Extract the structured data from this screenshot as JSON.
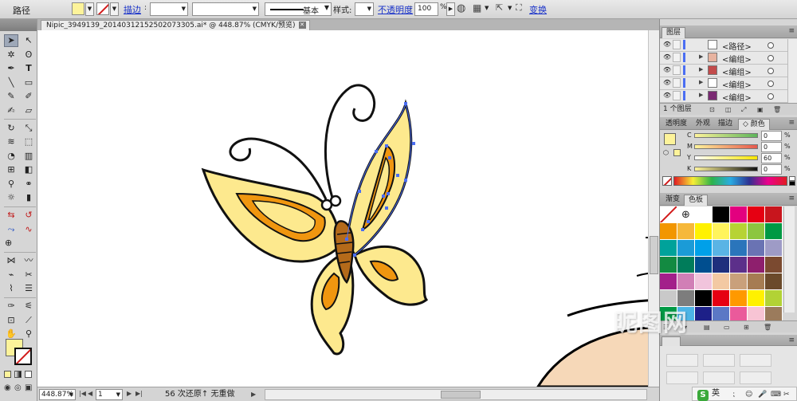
{
  "control_bar": {
    "title": "路径",
    "stroke_link": "描边",
    "stroke_width": "",
    "stroke_profile": "",
    "brush_label": "基本",
    "style_label": "样式:",
    "opacity_link": "不透明度",
    "opacity_value": "100",
    "opacity_unit": "%",
    "transform_link": "变换",
    "colors": {
      "fill": "#fdf39a",
      "accent_link": "#1a33c9"
    }
  },
  "document": {
    "tab_title": "Nipic_3949139_20140312152502073305.ai* @ 448.87% (CMYK/预览)"
  },
  "status_bar": {
    "zoom": "448.87%",
    "page": "1",
    "status_text": "56 次还原↑ 无重做"
  },
  "layers_panel": {
    "tab": "图层",
    "layers": [
      {
        "name": "<路径>"
      },
      {
        "name": "<编组>"
      },
      {
        "name": "<编组>"
      },
      {
        "name": "<编组>"
      },
      {
        "name": "<编组>"
      }
    ],
    "footer": "1 个图层"
  },
  "color_panel": {
    "tabs": [
      "透明度",
      "外观",
      "描边",
      "颜色"
    ],
    "active_tab": "颜色",
    "channels": [
      {
        "label": "C",
        "value": "0",
        "unit": "%",
        "color": "#00a7d8"
      },
      {
        "label": "M",
        "value": "0",
        "unit": "%",
        "color": "#e6007e"
      },
      {
        "label": "Y",
        "value": "60",
        "unit": "%",
        "color": "#f7e500"
      },
      {
        "label": "K",
        "value": "0",
        "unit": "%",
        "color": "#000000"
      }
    ]
  },
  "swatches_panel": {
    "tabs": [
      "渐变",
      "色板"
    ],
    "active_tab": "色板",
    "swatches": [
      "#ffffff",
      "#ffffff",
      "#ffffff",
      "#000000",
      "#e3007f",
      "#e60012",
      "#c8151d",
      "#f29600",
      "#f6b83a",
      "#fff100",
      "#fff45c",
      "#b7d334",
      "#8cc63f",
      "#009944",
      "#00a29a",
      "#1b9bd7",
      "#00a0e9",
      "#5ab4e5",
      "#2a75bb",
      "#6a73b3",
      "#9e9bc6",
      "#138a41",
      "#007c5a",
      "#004e8f",
      "#1f2f7d",
      "#5c2f8a",
      "#8e1f6d",
      "#7b4a30",
      "#a31f8a",
      "#d17fb6",
      "#f1c4dc",
      "#f3c9a3",
      "#c9a07b",
      "#a67c52",
      "#6b4a2b",
      "#c9c9c9",
      "#7d7d7d",
      "#000000",
      "#e60012",
      "#ff9900",
      "#fff100",
      "#b2d235",
      "#009944",
      "#4cb5e6",
      "#1d2088",
      "#5b78c5",
      "#ea5a9b",
      "#f7c4d4",
      "#9b7b5c"
    ]
  },
  "watermark": "昵图网"
}
